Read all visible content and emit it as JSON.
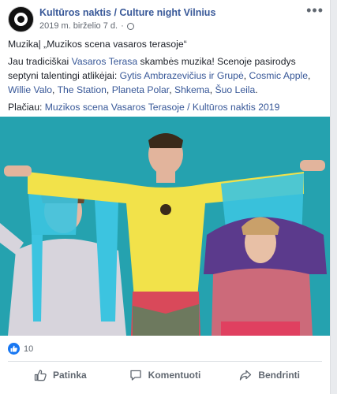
{
  "post": {
    "page_name": "Kultūros naktis / Culture night Vilnius",
    "timestamp": "2019 m. birželio 7 d.",
    "text_line1": "Muzika| „Muzikos scena vasaros terasoje“",
    "p2_a": "Jau tradiciškai ",
    "p2_link1": "Vasaros Terasa",
    "p2_b": " skambės muzika! Scenoje pasirodys septyni talentingi atlikėjai: ",
    "p2_link2": "Gytis Ambrazevičius ir Grupė",
    "p2_c": ", ",
    "p2_link3": "Cosmic Apple",
    "p2_d": ", ",
    "p2_link4": "Willie Valo",
    "p2_e": ", ",
    "p2_link5": "The Station",
    "p2_f": ", ",
    "p2_link6": "Planeta Polar",
    "p2_g": ", ",
    "p2_link7": "Shkema",
    "p2_h": ", ",
    "p2_link8": "Šuo Leila",
    "p2_i": ".",
    "p3_a": "Plačiau: ",
    "p3_link": "Muzikos scena Vasaros Terasoje / Kultūros naktis 2019",
    "reaction_count": "10"
  },
  "actions": {
    "like": "Patinka",
    "comment": "Komentuoti",
    "share": "Bendrinti"
  },
  "icons": {
    "more": "more-icon",
    "globe": "globe-icon",
    "like": "thumbs-up-icon",
    "comment": "comment-icon",
    "share": "share-icon"
  },
  "colors": {
    "link": "#385898",
    "photo_bg": "#2aa6b2",
    "like_blue": "#1877f2"
  }
}
